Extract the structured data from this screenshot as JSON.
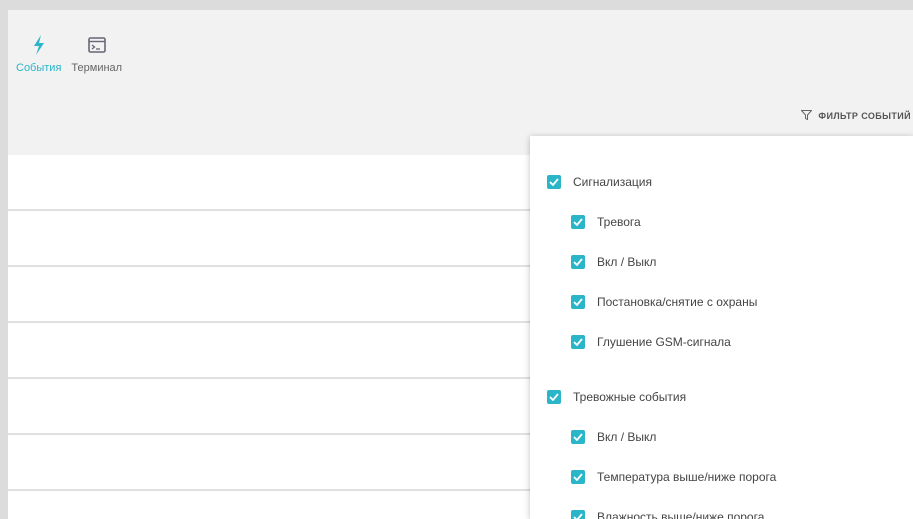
{
  "tabs": [
    {
      "label": "События",
      "icon": "lightning-icon",
      "active": true
    },
    {
      "label": "Терминал",
      "icon": "terminal-icon",
      "active": false
    }
  ],
  "filter": {
    "label": "ФИЛЬТР СОБЫТИЙ",
    "icon": "filter-icon",
    "groups": [
      {
        "label": "Сигнализация",
        "checked": true,
        "items": [
          {
            "label": "Тревога",
            "checked": true
          },
          {
            "label": "Вкл / Выкл",
            "checked": true
          },
          {
            "label": "Постановка/снятие с охраны",
            "checked": true
          },
          {
            "label": "Глушение GSM-сигнала",
            "checked": true
          }
        ]
      },
      {
        "label": "Тревожные события",
        "checked": true,
        "items": [
          {
            "label": "Вкл / Выкл",
            "checked": true
          },
          {
            "label": "Температура выше/ниже порога",
            "checked": true
          },
          {
            "label": "Влажность выше/ниже порога",
            "checked": true
          }
        ]
      }
    ]
  },
  "colors": {
    "accent": "#2bb5c8",
    "header_bg": "#f2f2f2",
    "row_divider": "#e0e0e0"
  }
}
